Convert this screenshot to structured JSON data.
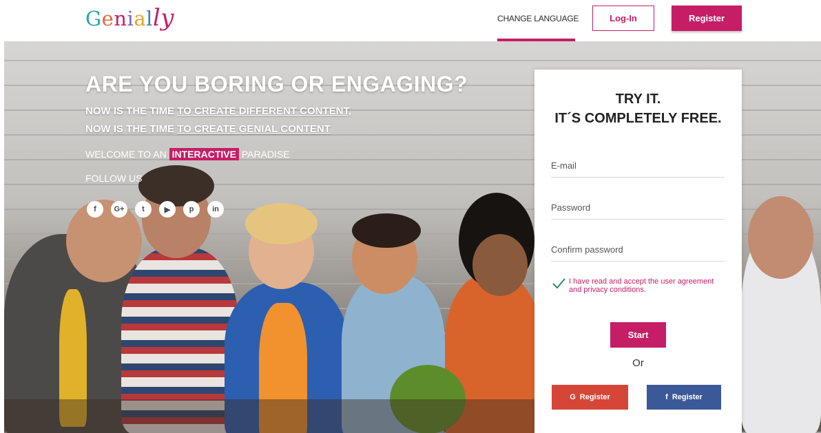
{
  "header": {
    "logo_text": "Genially",
    "change_language": "CHANGE LANGUAGE",
    "login_label": "Log-In",
    "register_label": "Register"
  },
  "hero": {
    "headline": "ARE YOU BORING OR ENGAGING?",
    "line1_prefix": "NOW IS THE TIME ",
    "line1_link": "TO CREATE DIFFERENT CONTENT,",
    "line2_prefix": "NOW IS THE TIME ",
    "line2_link": "TO CREATE GENIAL CONTENT",
    "welcome_prefix": "WELCOME TO AN ",
    "welcome_highlight": "INTERACTIVE",
    "welcome_suffix": " PARADISE",
    "follow_us": "FOLLOW US",
    "social": [
      {
        "icon": "facebook-icon",
        "glyph": "f"
      },
      {
        "icon": "google-plus-icon",
        "glyph": "G+"
      },
      {
        "icon": "twitter-icon",
        "glyph": "t"
      },
      {
        "icon": "youtube-icon",
        "glyph": "▶"
      },
      {
        "icon": "pinterest-icon",
        "glyph": "p"
      },
      {
        "icon": "linkedin-icon",
        "glyph": "in"
      }
    ]
  },
  "form": {
    "title_line1": "TRY IT.",
    "title_line2": "IT´S COMPLETELY FREE.",
    "email_placeholder": "E-mail",
    "password_placeholder": "Password",
    "confirm_placeholder": "Confirm password",
    "agreement": "I have read and accept the user agreement and privacy conditions.",
    "start_label": "Start",
    "or_label": "Or",
    "google_glyph": "G",
    "google_label": "Register",
    "facebook_glyph": "f",
    "facebook_label": "Register"
  },
  "colors": {
    "brand": "#c61e66",
    "google": "#d64637",
    "facebook": "#3b5998"
  }
}
